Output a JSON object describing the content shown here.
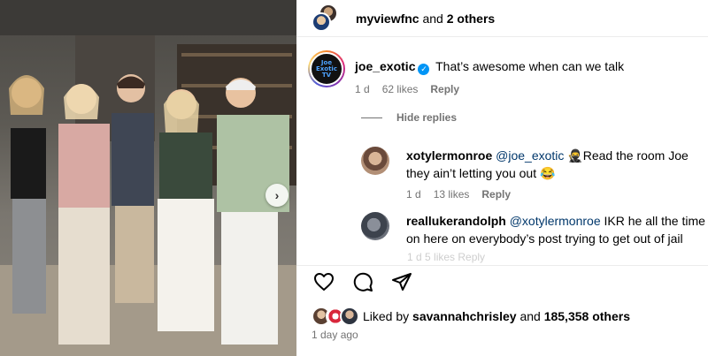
{
  "post": {
    "image_alt": "Family photo of five people",
    "carousel_next_icon": "chevron-right-icon"
  },
  "header": {
    "username": "myviewfnc",
    "others_text": "and",
    "others_count": "2 others"
  },
  "comments": [
    {
      "username": "joe_exotic",
      "verified": true,
      "text": "That’s awesome when can we talk",
      "age": "1 d",
      "likes": "62 likes",
      "reply_label": "Reply",
      "avatar_text": "Joe Exotic TV"
    }
  ],
  "hide_replies_label": "Hide replies",
  "replies": [
    {
      "username": "xotylermonroe",
      "mention": "@joe_exotic",
      "text_line1": "Read the room Joe",
      "text_line2": "they ain’t letting you out",
      "emoji_ninja": "🥷",
      "emoji_laugh": "😂",
      "age": "1 d",
      "likes": "13 likes",
      "reply_label": "Reply"
    },
    {
      "username": "reallukerandolph",
      "mention": "@xotylermonroe",
      "text_line1": "IKR he all the time",
      "text_line2": "on here on everybody’s post trying to get out of jail",
      "faded_meta": "1 d   5 likes   Reply"
    }
  ],
  "actions": {
    "like_icon": "heart-icon",
    "comment_icon": "comment-icon",
    "share_icon": "share-icon"
  },
  "likes_summary": {
    "prefix": "Liked by",
    "user": "savannahchrisley",
    "and": "and",
    "others": "185,358 others"
  },
  "timestamp": "1 day ago"
}
